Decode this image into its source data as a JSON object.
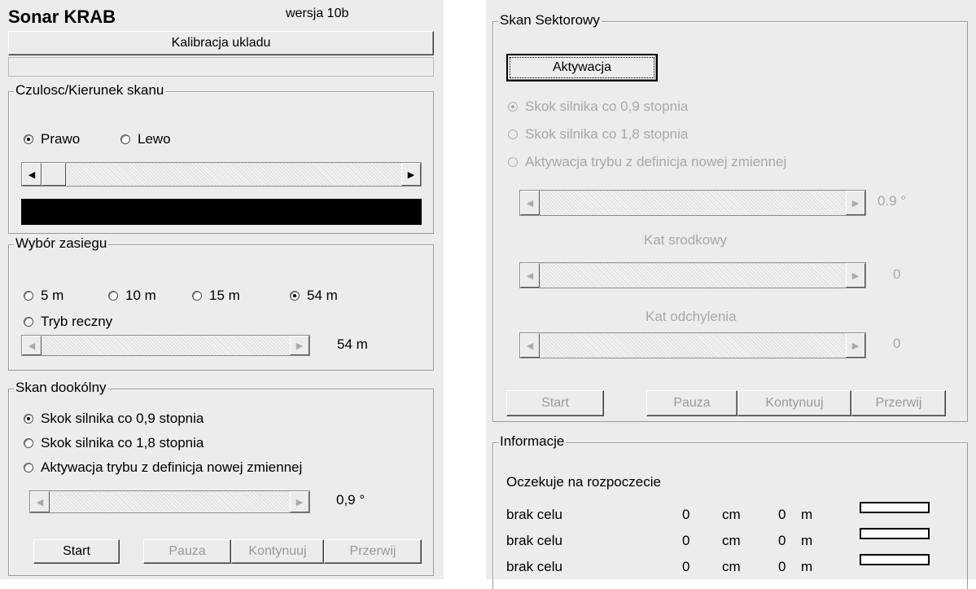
{
  "left": {
    "app_title": "Sonar KRAB",
    "version": "wersja 10b",
    "calibrate_button": "Kalibracja ukladu",
    "sensitivity": {
      "title": "Czulosc/Kierunek skanu",
      "direction_options": [
        "Prawo",
        "Lewo"
      ],
      "selected_direction": "Prawo"
    },
    "range": {
      "title": "Wybór zasiegu",
      "options": [
        "5 m",
        "10 m",
        "15 m",
        "54 m"
      ],
      "selected": "54 m",
      "manual_mode": "Tryb reczny",
      "slider_value": "54 m"
    },
    "round_scan": {
      "title": "Skan dookólny",
      "options": [
        "Skok silnika co 0,9 stopnia",
        "Skok silnika co 1,8 stopnia",
        "Aktywacja trybu z definicja nowej zmiennej"
      ],
      "selected": "Skok silnika co 0,9 stopnia",
      "slider_value": "0,9 °",
      "buttons": {
        "start": "Start",
        "pause": "Pauza",
        "continue": "Kontynuuj",
        "stop": "Przerwij"
      }
    }
  },
  "right": {
    "sector_scan": {
      "title": "Skan Sektorowy",
      "activate_button": "Aktywacja",
      "options": [
        "Skok silnika co 0,9 stopnia",
        "Skok silnika co 1,8 stopnia",
        "Aktywacja trybu z definicja nowej zmiennej"
      ],
      "selected": "Skok silnika co 0,9 stopnia",
      "step_value": "0.9 °",
      "center_angle_label": "Kat srodkowy",
      "center_angle_value": "0",
      "deflection_label": "Kat odchylenia",
      "deflection_value": "0",
      "buttons": {
        "start": "Start",
        "pause": "Pauza",
        "continue": "Kontynuuj",
        "stop": "Przerwij"
      }
    },
    "info": {
      "title": "Informacje",
      "status": "Oczekuje na rozpoczecie",
      "targets": [
        {
          "label": "brak celu",
          "cm": "0",
          "cm_unit": "cm",
          "m": "0",
          "m_unit": "m"
        },
        {
          "label": "brak celu",
          "cm": "0",
          "cm_unit": "cm",
          "m": "0",
          "m_unit": "m"
        },
        {
          "label": "brak celu",
          "cm": "0",
          "cm_unit": "cm",
          "m": "0",
          "m_unit": "m"
        }
      ]
    }
  }
}
